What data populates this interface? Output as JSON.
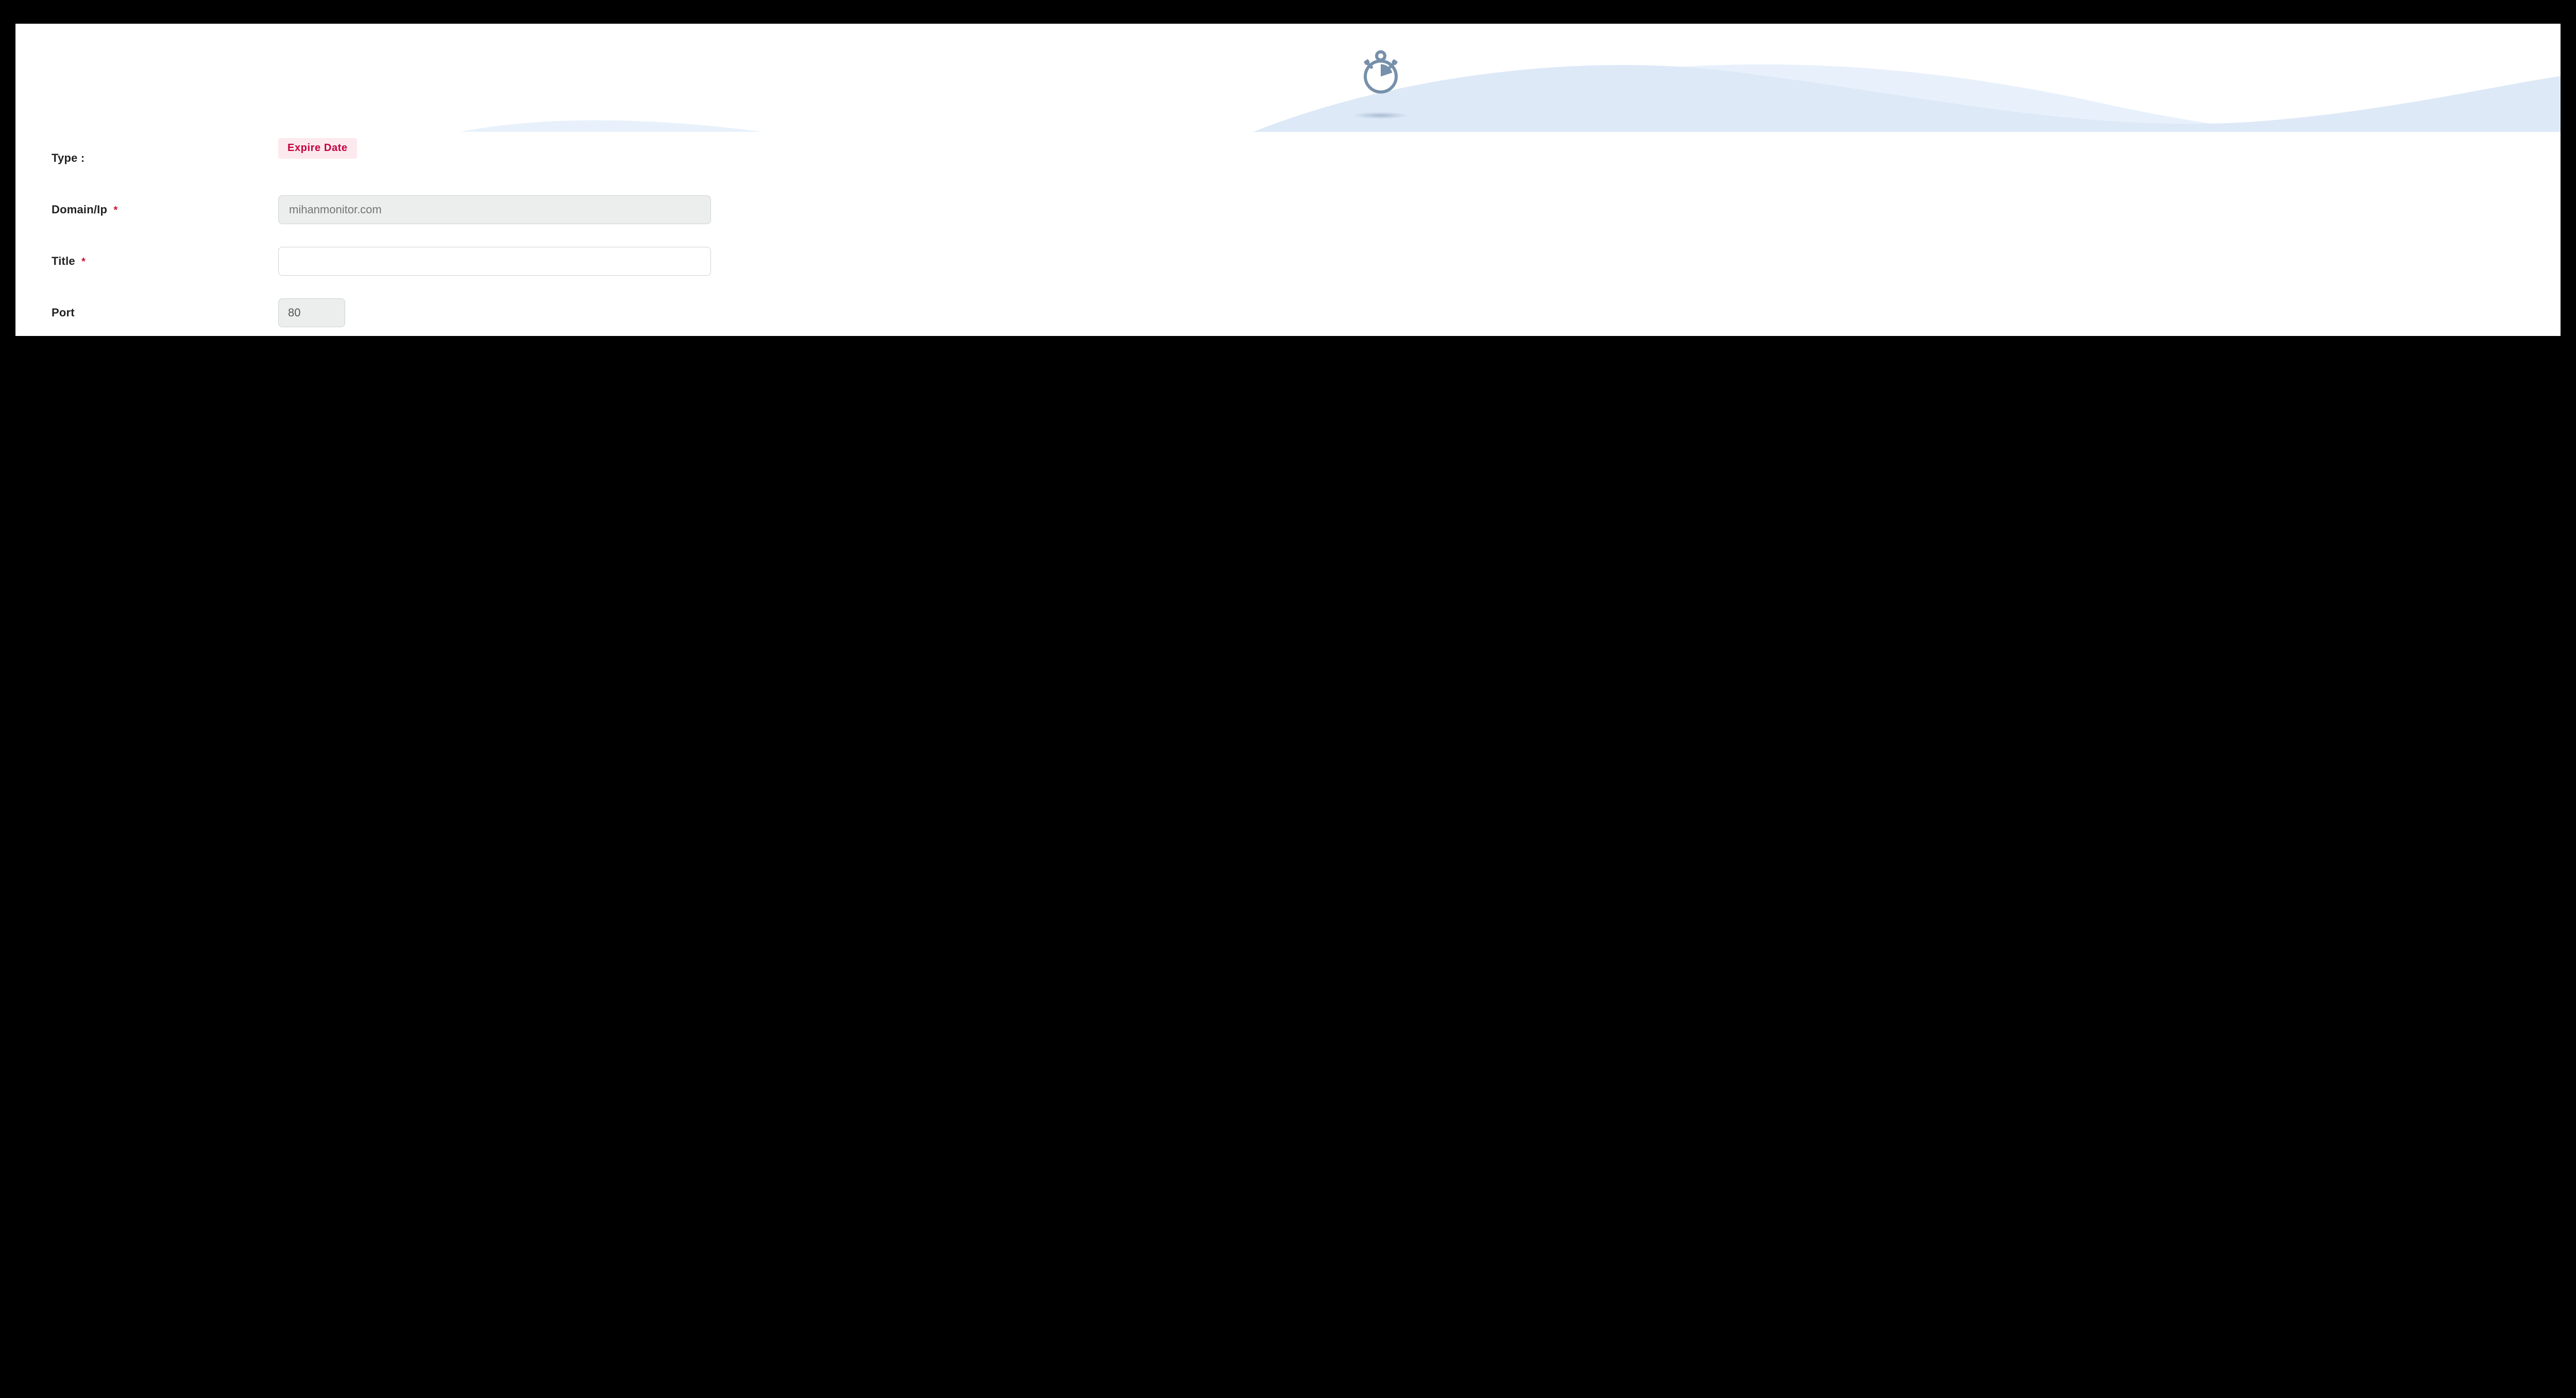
{
  "labels": {
    "type": "Type :",
    "domain": "Domain/Ip",
    "title": "Title",
    "port": "Port",
    "required_marker": "*"
  },
  "type_badge": "Expire Date",
  "fields": {
    "domain": {
      "placeholder": "mihanmonitor.com",
      "value": ""
    },
    "title": {
      "placeholder": "",
      "value": ""
    },
    "port": {
      "placeholder": "",
      "value": "80"
    }
  },
  "colors": {
    "accent": "#c3003c",
    "badge_bg": "#fce9ee",
    "icon": "#7790ab",
    "wash": "#e8f1fb"
  }
}
